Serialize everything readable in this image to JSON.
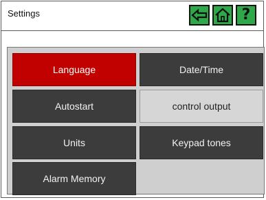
{
  "header": {
    "title": "Settings",
    "help_label": "?"
  },
  "nav_icons": {
    "back": "arrow-left-icon",
    "home": "home-icon",
    "help": "question-icon",
    "accent_color": "#2fa84a"
  },
  "menu": {
    "active_color": "#c10000",
    "items": [
      {
        "label": "Language",
        "state": "active"
      },
      {
        "label": "Date/Time",
        "state": "normal"
      },
      {
        "label": "Autostart",
        "state": "normal"
      },
      {
        "label": "control output",
        "state": "disabled"
      },
      {
        "label": "Units",
        "state": "normal"
      },
      {
        "label": "Keypad tones",
        "state": "normal"
      },
      {
        "label": "Alarm Memory",
        "state": "normal"
      }
    ]
  }
}
